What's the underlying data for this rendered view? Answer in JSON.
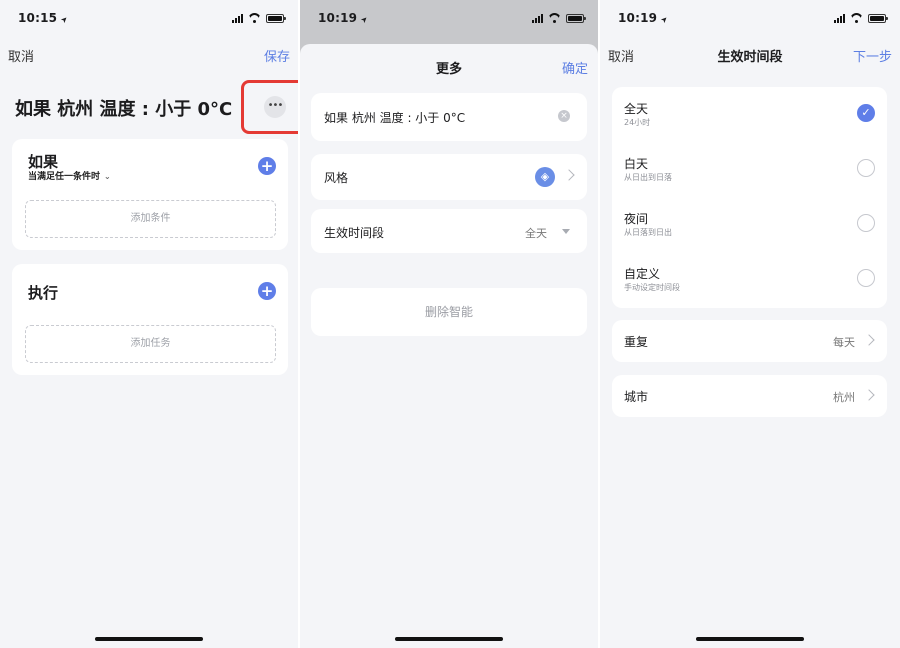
{
  "screen1": {
    "time": "10:15",
    "cancel": "取消",
    "save": "保存",
    "title": "如果 杭州 温度 : 小于 0°C",
    "more_glyph": "•••",
    "if_card": {
      "title": "如果",
      "subtitle": "当满足任一条件时",
      "add_label": "添加条件"
    },
    "do_card": {
      "title": "执行",
      "add_label": "添加任务"
    }
  },
  "screen2": {
    "time": "10:19",
    "title": "更多",
    "confirm": "确定",
    "name_value": "如果 杭州 温度 : 小于 0°C",
    "style_label": "风格",
    "period_label": "生效时间段",
    "period_value": "全天",
    "delete_label": "删除智能"
  },
  "screen3": {
    "time": "10:19",
    "cancel": "取消",
    "title": "生效时间段",
    "next": "下一步",
    "options": [
      {
        "title": "全天",
        "subtitle": "24小时",
        "selected": true
      },
      {
        "title": "白天",
        "subtitle": "从日出到日落",
        "selected": false
      },
      {
        "title": "夜间",
        "subtitle": "从日落到日出",
        "selected": false
      },
      {
        "title": "自定义",
        "subtitle": "手动设定时间段",
        "selected": false
      }
    ],
    "repeat_label": "重复",
    "repeat_value": "每天",
    "city_label": "城市",
    "city_value": "杭州"
  },
  "colors": {
    "accent": "#5d7fe3",
    "highlight": "#e43a34",
    "background": "#f4f5f8"
  },
  "icons": [
    "location-arrow-icon",
    "signal-icon",
    "wifi-icon",
    "battery-icon",
    "more-icon",
    "plus-icon",
    "clear-icon",
    "style-tag-icon",
    "chevron-right-icon",
    "caret-down-icon",
    "check-icon"
  ]
}
